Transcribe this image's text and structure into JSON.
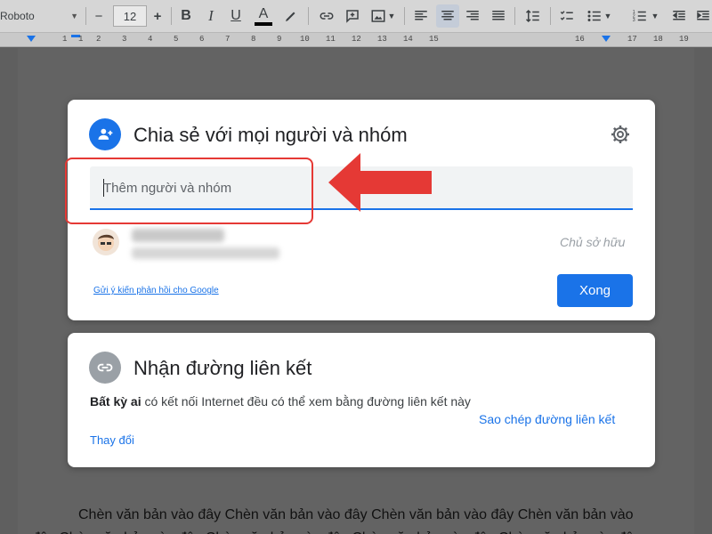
{
  "toolbar": {
    "font": "Roboto",
    "size": "12",
    "icons": [
      "minus-icon",
      "plus-icon",
      "bold-icon",
      "italic-icon",
      "underline-icon",
      "text-color-icon",
      "highlight-pen-icon",
      "link-icon",
      "comment-icon",
      "image-icon",
      "align-left-icon",
      "align-center-icon",
      "align-right-icon",
      "align-justify-icon",
      "line-spacing-icon",
      "checklist-icon",
      "bullet-list-icon",
      "numbered-list-icon",
      "indent-decrease-icon"
    ]
  },
  "ruler": {
    "marks": [
      "1",
      "1",
      "2",
      "3",
      "4",
      "5",
      "6",
      "7",
      "8",
      "9",
      "10",
      "11",
      "12",
      "13",
      "14",
      "15",
      "16",
      "17",
      "18",
      "19"
    ]
  },
  "share_card": {
    "title": "Chia sẻ với mọi người và nhóm",
    "input_placeholder": "Thêm người và nhóm",
    "owner_role": "Chủ sở hữu",
    "feedback_link": "Gửi ý kiến phản hồi cho Google",
    "done_button": "Xong"
  },
  "link_card": {
    "title": "Nhận đường liên kết",
    "desc_bold": "Bất kỳ ai",
    "desc_rest": " có kết nối Internet đều có thể xem bằng đường liên kết này",
    "change": "Thay đổi",
    "copy_link": "Sao chép đường liên kết"
  },
  "document": {
    "body_text": "Chèn văn bản vào đây Chèn văn bản vào đây Chèn văn bản vào đây Chèn văn bản vào đây Chèn văn bản vào đây Chèn văn bản vào đây Chèn văn bản vào đây Chèn văn bản vào đây"
  },
  "colors": {
    "accent": "#1a73e8",
    "annotation": "#e53935"
  }
}
